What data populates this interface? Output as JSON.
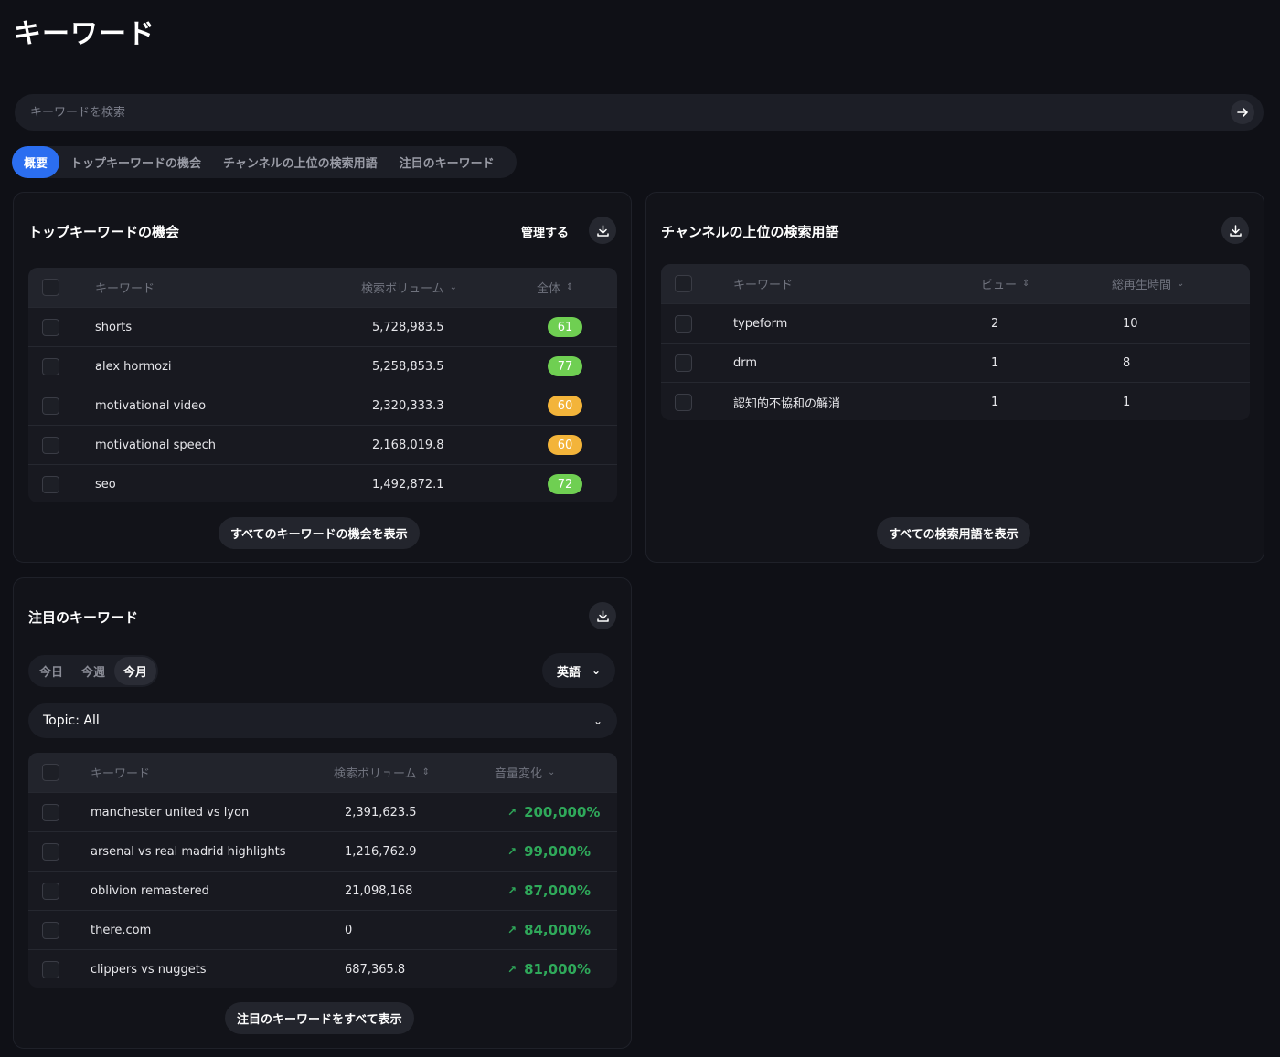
{
  "page": {
    "title": "キーワード"
  },
  "search": {
    "placeholder": "キーワードを検索"
  },
  "tabs": [
    {
      "label": "概要",
      "active": true
    },
    {
      "label": "トップキーワードの機会"
    },
    {
      "label": "チャンネルの上位の検索用語"
    },
    {
      "label": "注目のキーワード"
    }
  ],
  "opportunities": {
    "title": "トップキーワードの機会",
    "manage_label": "管理する",
    "columns": [
      "キーワード",
      "検索ボリューム",
      "全体"
    ],
    "rows": [
      {
        "keyword": "shorts",
        "volume": "5,728,983.5",
        "score": "61",
        "color": "green"
      },
      {
        "keyword": "alex hormozi",
        "volume": "5,258,853.5",
        "score": "77",
        "color": "green"
      },
      {
        "keyword": "motivational video",
        "volume": "2,320,333.3",
        "score": "60",
        "color": "amber"
      },
      {
        "keyword": "motivational speech",
        "volume": "2,168,019.8",
        "score": "60",
        "color": "amber"
      },
      {
        "keyword": "seo",
        "volume": "1,492,872.1",
        "score": "72",
        "color": "green"
      }
    ],
    "show_all_label": "すべてのキーワードの機会を表示"
  },
  "channel_terms": {
    "title": "チャンネルの上位の検索用語",
    "columns": [
      "キーワード",
      "ビュー",
      "総再生時間"
    ],
    "rows": [
      {
        "keyword": "typeform",
        "views": "2",
        "watch": "10"
      },
      {
        "keyword": "drm",
        "views": "1",
        "watch": "8"
      },
      {
        "keyword": "認知的不協和の解消",
        "views": "1",
        "watch": "1"
      }
    ],
    "show_all_label": "すべての検索用語を表示"
  },
  "trending": {
    "title": "注目のキーワード",
    "periods": [
      {
        "label": "今日"
      },
      {
        "label": "今週"
      },
      {
        "label": "今月",
        "active": true
      }
    ],
    "language": "英語",
    "topic": "Topic: All",
    "columns": [
      "キーワード",
      "検索ボリューム",
      "音量変化"
    ],
    "rows": [
      {
        "keyword": "manchester united vs lyon",
        "volume": "2,391,623.5",
        "change": "200,000%"
      },
      {
        "keyword": "arsenal vs real madrid highlights",
        "volume": "1,216,762.9",
        "change": "99,000%"
      },
      {
        "keyword": "oblivion remastered",
        "volume": "21,098,168",
        "change": "87,000%"
      },
      {
        "keyword": "there.com",
        "volume": "0",
        "change": "84,000%"
      },
      {
        "keyword": "clippers vs nuggets",
        "volume": "687,365.8",
        "change": "81,000%"
      }
    ],
    "show_all_label": "注目のキーワードをすべて表示"
  },
  "colors": {
    "accent": "#2b6ef0",
    "green_badge": "#6fcf52",
    "amber_badge": "#f3b43a",
    "trend_up": "#2fa95a"
  }
}
